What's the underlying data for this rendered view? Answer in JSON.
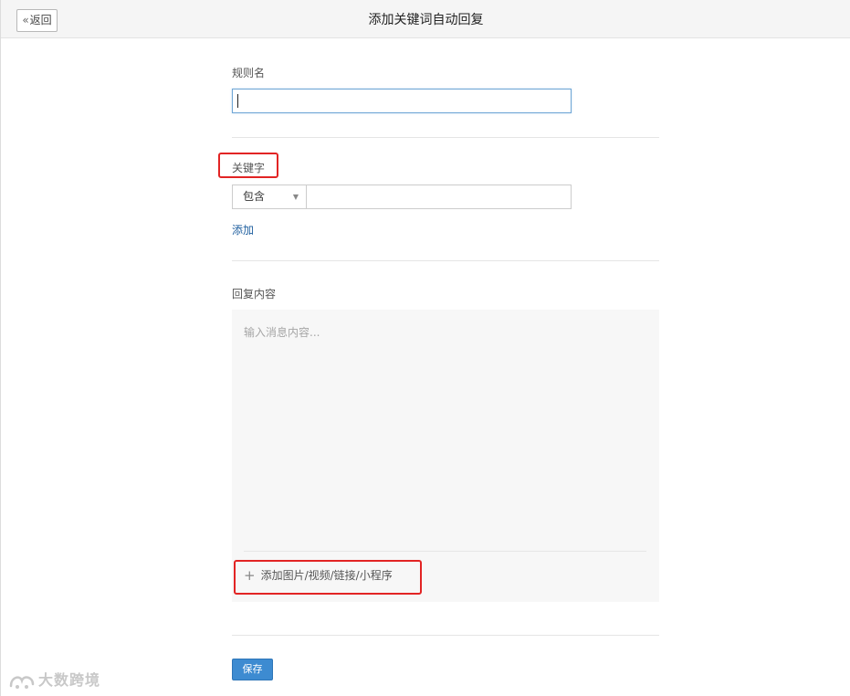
{
  "header": {
    "back_label": "返回",
    "title": "添加关键词自动回复"
  },
  "form": {
    "rule_name_label": "规则名",
    "rule_name_value": "",
    "keyword_label": "关键字",
    "match_mode_selected": "包含",
    "keyword_value": "",
    "add_keyword_link": "添加",
    "reply_label": "回复内容",
    "reply_placeholder": "输入消息内容...",
    "attach_label": "添加图片/视频/链接/小程序",
    "save_label": "保存"
  },
  "watermark": {
    "text": "大数跨境"
  },
  "colors": {
    "highlight": "#e22424",
    "save_button": "#3d8bd1",
    "link": "#1f5f9f"
  },
  "icons": {
    "back": "double-chevron-left-icon",
    "dropdown": "triangle-down-icon",
    "attach": "plus-icon"
  }
}
